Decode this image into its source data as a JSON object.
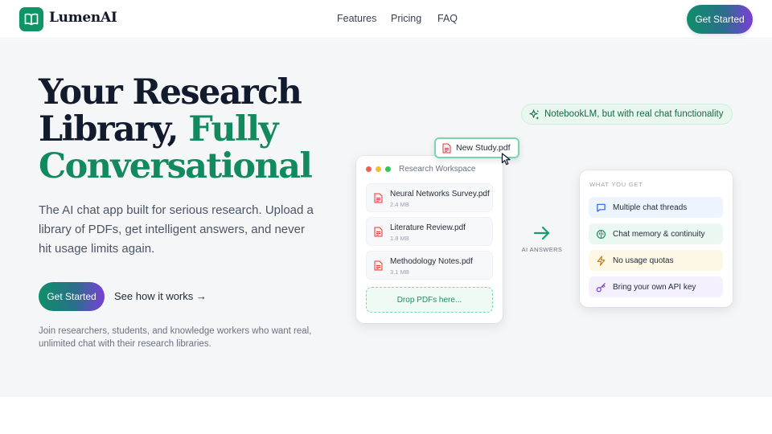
{
  "brand": {
    "name": "LumenAI",
    "logo_icon": "open-book-icon",
    "accent": "#0f9467"
  },
  "nav": {
    "features": "Features",
    "pricing": "Pricing",
    "faq": "FAQ",
    "cta": "Get Started"
  },
  "hero": {
    "headline_line1": "Your Research",
    "headline_line2_plain": "Library, ",
    "headline_line2_accent": "Fully",
    "headline_line3_accent": "Conversational",
    "subhead": "The AI chat app built for serious research. Upload a library of PDFs, get intelligent answers, and never hit usage limits again.",
    "cta": "Get Started",
    "secondary_link": "See how it works →",
    "footnote": "Join researchers, students, and knowledge workers who want real, unlimited chat with their research libraries."
  },
  "tagline": {
    "icon": "sparkles-icon",
    "text": "NotebookLM, but with real chat functionality"
  },
  "workspace": {
    "title": "Research Workspace",
    "files": [
      {
        "name": "Neural Networks Survey.pdf",
        "size": "2.4 MB",
        "icon": "pdf-file-icon"
      },
      {
        "name": "Literature Review.pdf",
        "size": "1.8 MB",
        "icon": "pdf-file-icon"
      },
      {
        "name": "Methodology Notes.pdf",
        "size": "3.1 MB",
        "icon": "pdf-file-icon"
      }
    ],
    "dropzone": "Drop PDFs here...",
    "dragging_file": "New Study.pdf"
  },
  "flow": {
    "label": "AI ANSWERS",
    "icon": "arrow-right-icon"
  },
  "benefits": {
    "title": "WHAT YOU GET",
    "items": [
      {
        "label": "Multiple chat threads",
        "icon": "chat-bubble-icon",
        "color": "#2563eb"
      },
      {
        "label": "Chat memory & continuity",
        "icon": "brain-icon",
        "color": "#15935f"
      },
      {
        "label": "No usage quotas",
        "icon": "lightning-icon",
        "color": "#d97706"
      },
      {
        "label": "Bring your own API key",
        "icon": "key-icon",
        "color": "#7c3aed"
      }
    ]
  }
}
